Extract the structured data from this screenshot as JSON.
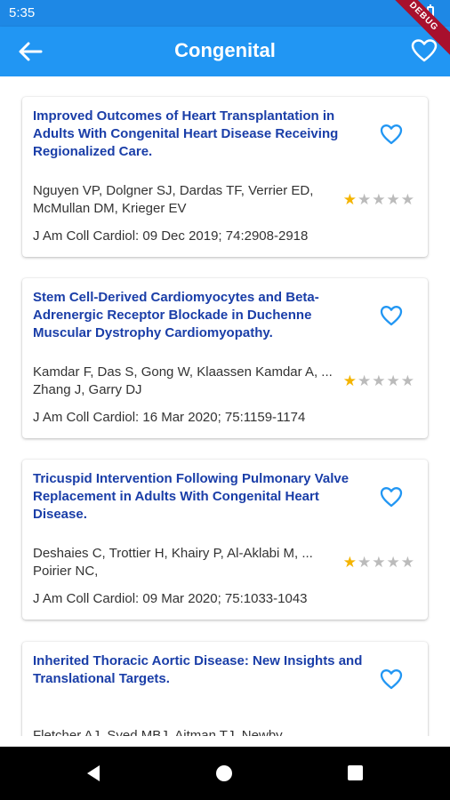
{
  "status_bar": {
    "time": "5:35",
    "debug_label": "DEBUG"
  },
  "app_bar": {
    "title": "Congenital",
    "back_icon": "arrow-back-icon",
    "favorite_icon": "heart-outline-icon"
  },
  "colors": {
    "primary": "#2196f3",
    "status_bar": "#1e88e5",
    "title_link": "#1a3ea8",
    "star_on": "#f4b400",
    "star_off": "#bbbbbb"
  },
  "articles": [
    {
      "title": "Improved Outcomes of Heart Transplantation in Adults With Congenital Heart Disease Receiving Regionalized Care.",
      "authors": "Nguyen VP, Dolgner SJ, Dardas TF, Verrier ED, McMullan DM, Krieger EV",
      "journal": "J Am Coll Cardiol: 09 Dec 2019; 74:2908-2918",
      "rating": 1
    },
    {
      "title": "Stem Cell-Derived Cardiomyocytes and Beta-Adrenergic Receptor Blockade in Duchenne Muscular Dystrophy Cardiomyopathy.",
      "authors": "Kamdar F, Das S, Gong W, Klaassen Kamdar A, ... Zhang J, Garry DJ",
      "journal": "J Am Coll Cardiol: 16 Mar 2020; 75:1159-1174",
      "rating": 1
    },
    {
      "title": "Tricuspid Intervention Following Pulmonary Valve Replacement in Adults With Congenital Heart Disease.",
      "authors": "Deshaies C, Trottier H, Khairy P, Al-Aklabi M, ... Poirier NC,",
      "journal": "J Am Coll Cardiol: 09 Mar 2020; 75:1033-1043",
      "rating": 1
    },
    {
      "title": "Inherited Thoracic Aortic Disease: New Insights and Translational Targets.",
      "authors": "Fletcher AJ, Syed MBJ, Aitman TJ, Newby",
      "journal": "",
      "rating": 0
    }
  ],
  "nav_bar": {
    "back_icon": "nav-back-triangle-icon",
    "home_icon": "nav-home-circle-icon",
    "recents_icon": "nav-recents-square-icon"
  }
}
